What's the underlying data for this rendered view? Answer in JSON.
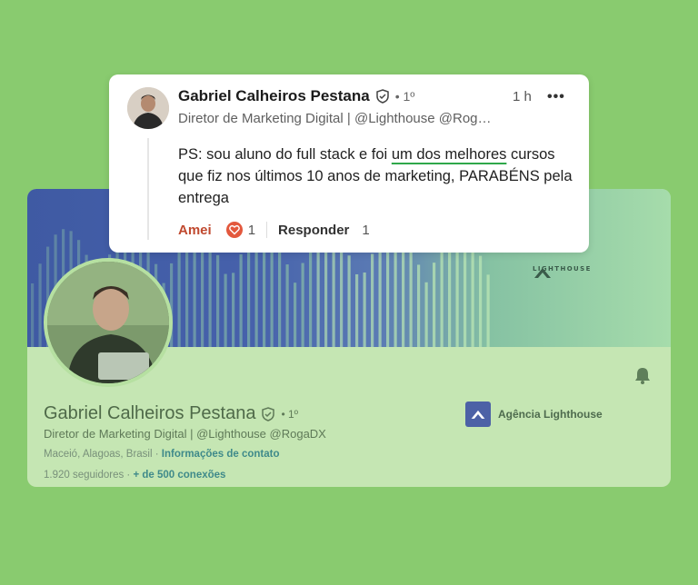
{
  "colors": {
    "background": "#89cb6f",
    "profile_card": "#c5e6b3",
    "banner_blue": "#4661ab",
    "link_teal": "#3f8a8a",
    "love_red": "#c0492f",
    "underline_green": "#2fa84a"
  },
  "comment": {
    "author": "Gabriel Calheiros Pestana",
    "degree": "• 1º",
    "time": "1 h",
    "more": "•••",
    "headline": "Diretor de Marketing Digital | @Lighthouse @Rog…",
    "body_before": "PS: sou aluno do full stack e foi ",
    "body_highlight": "um dos melhores",
    "body_after": " cursos que fiz nos últimos 10 anos de marketing, PARABÉNS pela entrega",
    "reaction_label": "Amei",
    "reaction_count": "1",
    "reply_label": "Responder",
    "reply_count": "1",
    "icons": [
      "verified-shield-icon",
      "more-icon",
      "heart-reaction-icon"
    ]
  },
  "profile": {
    "name": "Gabriel Calheiros Pestana",
    "degree": "• 1º",
    "headline": "Diretor de Marketing Digital | @Lighthouse @RogaDX",
    "location": "Maceió, Alagoas, Brasil",
    "location_sep": " · ",
    "contact_link": "Informações de contato",
    "followers": "1.920 seguidores",
    "stats_sep": " · ",
    "connections": "+ de 500 conexões",
    "company_name": "Agência Lighthouse",
    "banner_logo": "LIGHTHOUSE",
    "icons": [
      "verified-shield-icon",
      "bell-icon",
      "company-logo-icon"
    ]
  }
}
